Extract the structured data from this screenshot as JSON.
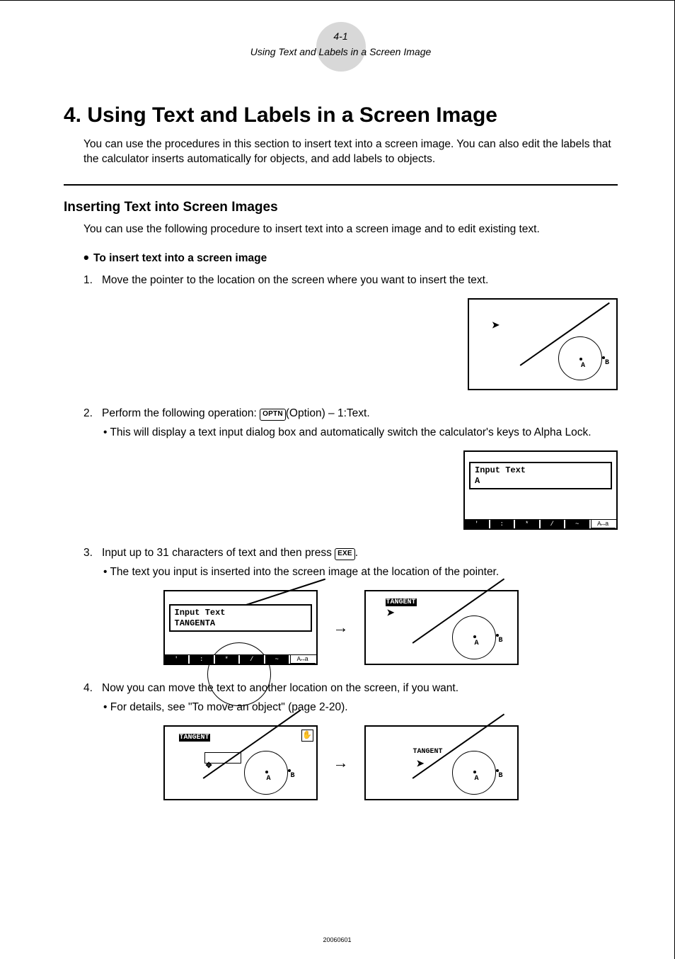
{
  "header": {
    "page_num": "4-1",
    "caption": "Using Text and Labels in a Screen Image"
  },
  "title": "4. Using Text and Labels in a Screen Image",
  "intro": "You can use the procedures in this section to insert text into a screen image. You can also edit the labels that the calculator inserts automatically for objects, and add labels to objects.",
  "section_heading": "Inserting Text into Screen Images",
  "section_intro": "You can use the following procedure to insert text into a screen image and to edit existing text.",
  "subsection_heading": "To insert text into a screen image",
  "steps": {
    "s1": {
      "num": "1.",
      "text": "Move the pointer to the location on the screen where you want to insert the text."
    },
    "s2": {
      "num": "2.",
      "text_before": "Perform the following operation: ",
      "key": "OPTN",
      "text_after": "(Option) – 1:Text.",
      "bullet": "This will display a text input dialog box and automatically switch the calculator's keys to Alpha Lock."
    },
    "s3": {
      "num": "3.",
      "text_before": "Input up to 31 characters of text and then press ",
      "key": "EXE",
      "text_after": ".",
      "bullet": "The text you input is inserted into the screen image at the location of the pointer."
    },
    "s4": {
      "num": "4.",
      "text": "Now you can move the text to another location on the screen, if you want.",
      "bullet": "For details, see \"To move an object\" (page 2-20)."
    }
  },
  "dialog": {
    "title": "Input Text",
    "cursor": "A",
    "typed": "TANGENTA"
  },
  "softkeys": {
    "k1": "'",
    "k2": ":",
    "k3": "*",
    "k4": "/",
    "k5": "~",
    "k6": "A↔a"
  },
  "screen_labels": {
    "A": "A",
    "B": "B",
    "tangent": "TANGENT"
  },
  "arrow": "→",
  "footer": "20060601"
}
